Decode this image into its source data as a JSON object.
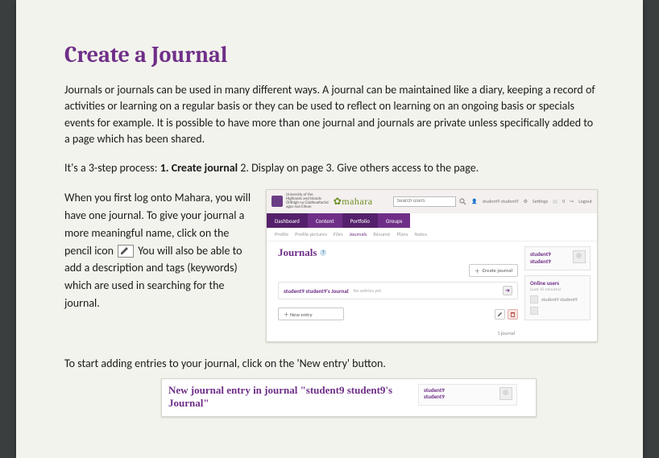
{
  "doc": {
    "title": "Create a Journal",
    "intro": "Journals or journals can be used in many different ways.  A journal can be maintained like a diary, keeping a record of activities or learning on a regular basis or they can be used to reflect on learning on an ongoing basis or specials events for example.   It is possible to have more than one journal and journals are private unless specifically added to a page which has been shared.",
    "steps_lead": "It's a 3-step process: ",
    "step1": "1. Create journal",
    "steps_tail": " 2. Display on page 3. Give others access to the page.",
    "para2a": "When you first log onto Mahara, you will have one journal.  To give your journal a more meaningful name, click on the pencil icon ",
    "para2b": "  You will also be able to add a description and tags (keywords) which are used in searching for the journal.",
    "next": "To start adding entries to your journal, click on the 'New entry' button."
  },
  "shot1": {
    "uni_lines": "University of the\nHighlands and Islands\nOilthigh na Gàidhealtachd\nagus nan Eilean",
    "brand": "mahara",
    "search_placeholder": "Search users",
    "top_user": "student9 student9",
    "top_settings": "Settings",
    "top_logout": "Logout",
    "nav": {
      "dashboard": "Dashboard",
      "content": "Content",
      "portfolio": "Portfolio",
      "groups": "Groups"
    },
    "subnav": {
      "a": "Profile",
      "b": "Profile pictures",
      "c": "Files",
      "d": "Journals",
      "e": "Résumé",
      "f": "Plans",
      "g": "Notes"
    },
    "heading": "Journals",
    "create_btn": "Create journal",
    "journal_title": "student9 student9's Journal",
    "journal_empty": "No entries yet.",
    "new_entry": "New entry",
    "footer": "1 journal",
    "side_name": "student9 student9",
    "online_users": "Online users",
    "online_sub": "(Last 10 minutes)",
    "online_row": "student9 student9"
  },
  "shot2": {
    "title": "New journal entry in journal \"student9 student9's Journal\"",
    "side_name_a": "student9",
    "side_name_b": "student9"
  }
}
